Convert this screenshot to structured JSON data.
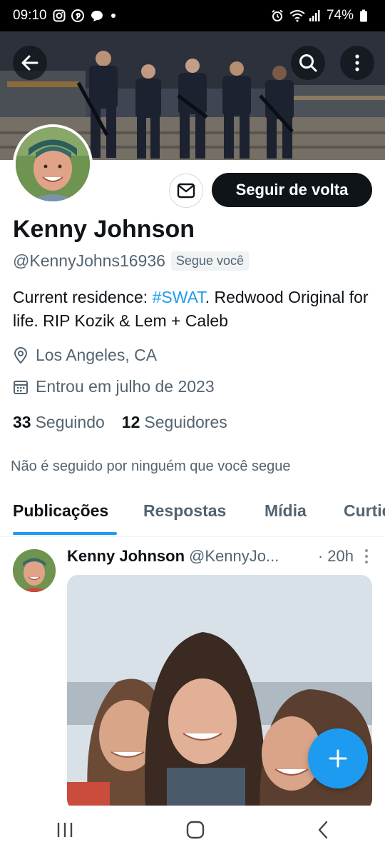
{
  "status_bar": {
    "time": "09:10",
    "battery": "74%",
    "left_icons": [
      "instagram-icon",
      "pinterest-icon",
      "chat-icon",
      "dot-icon"
    ],
    "right_icons": [
      "alarm-icon",
      "wifi-icon",
      "signal-icon",
      "battery-icon"
    ]
  },
  "header": {
    "back_icon": "arrow-left-icon",
    "search_icon": "search-icon",
    "more_icon": "more-vertical-icon"
  },
  "profile": {
    "name": "Kenny Johnson",
    "handle": "@KennyJohns16936",
    "follows_you": "Segue você",
    "bio_before": "Current residence: ",
    "bio_hashtag": "#SWAT",
    "bio_after": ". Redwood Original for life. RIP Kozik & Lem + Caleb",
    "location": "Los Angeles, CA",
    "joined": "Entrou em julho de 2023",
    "following_count": "33",
    "following_label": "Seguindo",
    "followers_count": "12",
    "followers_label": "Seguidores",
    "not_followed_text": "Não é seguido por ninguém que você segue",
    "follow_button": "Seguir de volta",
    "message_icon": "mail-icon"
  },
  "tabs": [
    {
      "label": "Publicações",
      "active": true
    },
    {
      "label": "Respostas",
      "active": false
    },
    {
      "label": "Mídia",
      "active": false
    },
    {
      "label": "Curtidas",
      "active": false
    }
  ],
  "post": {
    "author_name": "Kenny Johnson",
    "author_handle": "@KennyJo...",
    "time": "· 20h"
  },
  "colors": {
    "accent": "#1d9bf0",
    "text_primary": "#0f1419",
    "text_secondary": "#536471"
  }
}
